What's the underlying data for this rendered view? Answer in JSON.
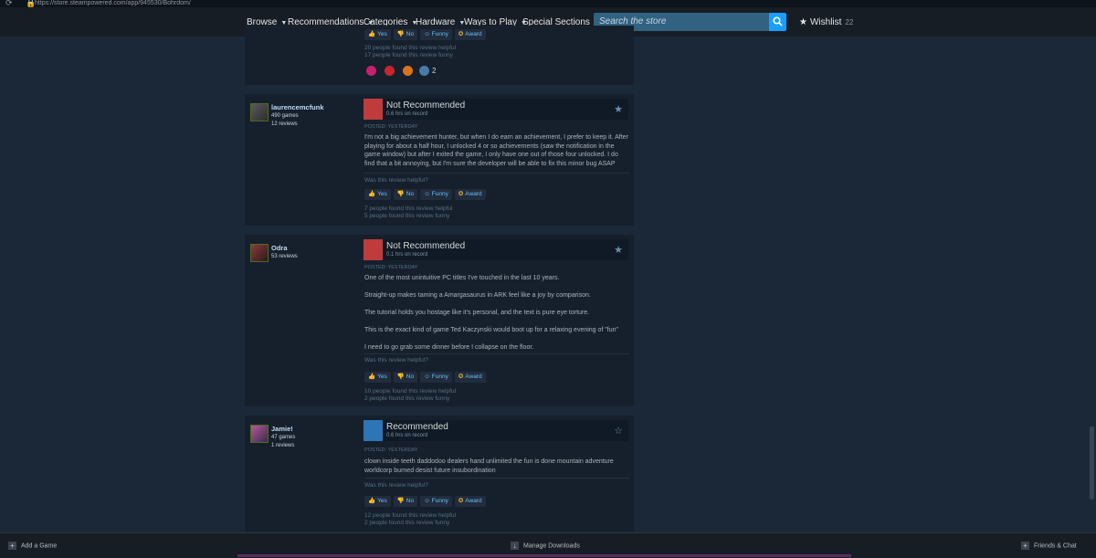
{
  "browser": {
    "url": "https://store.steampowered.com/app/945530/Bohrdom/"
  },
  "nav": {
    "items": [
      "Browse",
      "Recommendations",
      "Categories",
      "Hardware",
      "Ways to Play",
      "Special Sections"
    ],
    "search_placeholder": "Search the store",
    "wishlist_label": "Wishlist",
    "wishlist_count": "22"
  },
  "top_review": {
    "buttons": [
      "Yes",
      "No",
      "Funny",
      "Award"
    ],
    "helpful": "20 people found this review helpful",
    "funny": "17 people found this review funny",
    "award_count": "2"
  },
  "reviews": [
    {
      "author": "laurencemcfunk",
      "meta": [
        "490 games",
        "12 reviews"
      ],
      "verdict": "Not Recommended",
      "hours": "0.6 hrs on record",
      "posted": "POSTED: YESTERDAY",
      "paragraphs": [
        "I'm not a big achievement hunter, but when I do earn an achievement, I prefer to keep it. After playing for about a half hour, I unlocked 4 or so achievements (saw the notification in the game window) but after I exited the game, I only have one out of those four unlocked. I do find that a bit annoying, but I'm sure the developer will be able to fix this minor bug ASAP"
      ],
      "question": "Was this review helpful?",
      "buttons": [
        "Yes",
        "No",
        "Funny",
        "Award"
      ],
      "helpful": "7 people found this review helpful",
      "funny": "5 people found this review funny"
    },
    {
      "author": "Odra",
      "meta": [
        "53 reviews"
      ],
      "verdict": "Not Recommended",
      "hours": "0.1 hrs on record",
      "posted": "POSTED: YESTERDAY",
      "paragraphs": [
        "One of the most unintuitive PC titles I've touched in the last 10 years.",
        "Straight-up makes taming a Amargasaurus in ARK feel like a joy by comparison.",
        "The tutorial holds you hostage like it's personal, and the text is pure eye torture.",
        "This is the exact kind of game Ted Kaczynski would boot up for a relaxing evening of \"fun\"",
        "I need to go grab some dinner before I collapse on the floor."
      ],
      "question": "Was this review helpful?",
      "buttons": [
        "Yes",
        "No",
        "Funny",
        "Award"
      ],
      "helpful": "10 people found this review helpful",
      "funny": "2 people found this review funny"
    },
    {
      "author": "Jamie!",
      "meta": [
        "47 games",
        "1 reviews"
      ],
      "verdict": "Recommended",
      "hours": "0.6 hrs on record",
      "posted": "POSTED: YESTERDAY",
      "paragraphs": [
        "clown inside teeth daddodoo dealers hand unlimited the fun is done mountain adventure worldcorp burned desist future insubordination"
      ],
      "question": "Was this review helpful?",
      "buttons": [
        "Yes",
        "No",
        "Funny",
        "Award"
      ],
      "helpful": "12 people found this review helpful",
      "funny": "2 people found this review funny"
    }
  ],
  "footer": {
    "add_game": "Add a Game",
    "manage_downloads": "Manage Downloads",
    "friends_chat": "Friends & Chat"
  },
  "colors": {
    "background": "#1b2838",
    "card": "#16202d",
    "accent": "#66c0f4",
    "search_button": "#1a9fff",
    "not_recommended": "#be3c3c",
    "recommended": "#2d75b5"
  }
}
